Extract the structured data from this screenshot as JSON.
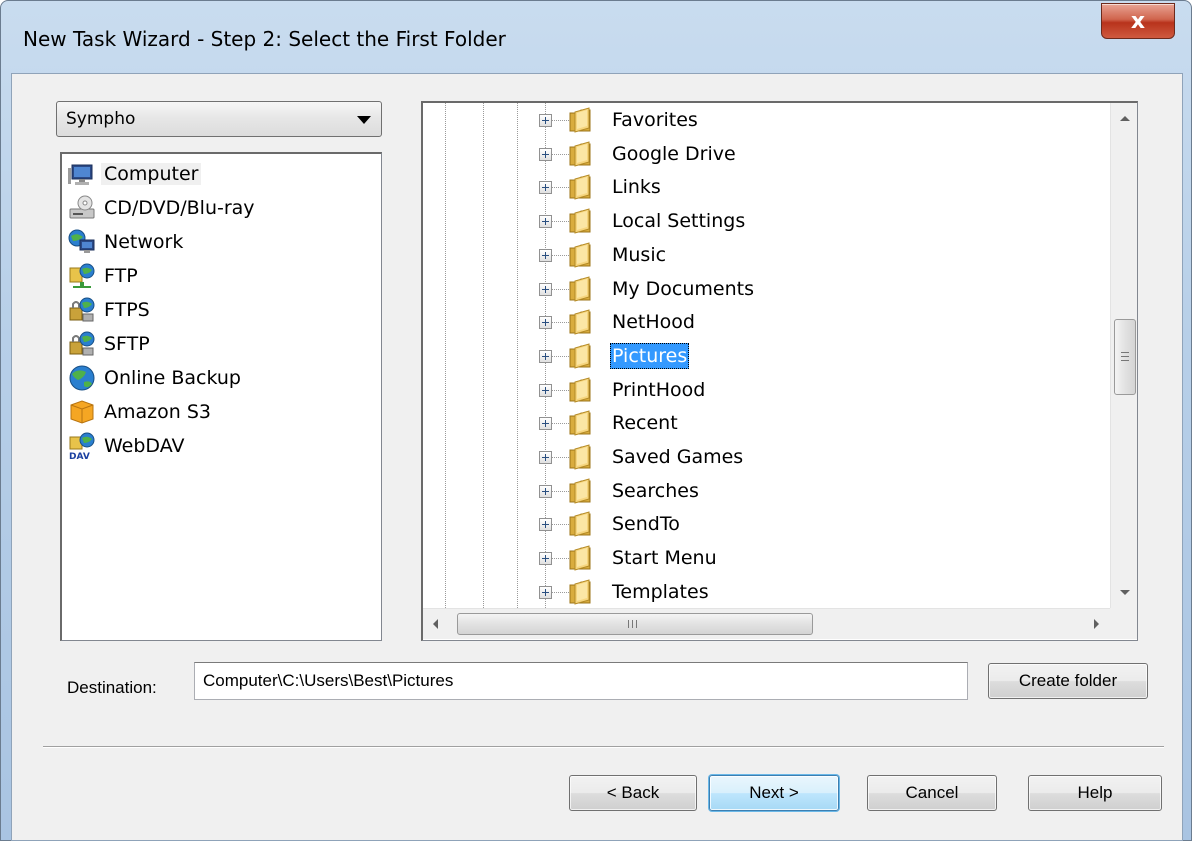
{
  "window": {
    "title": "New Task Wizard - Step 2: Select the First Folder",
    "close_glyph": "x"
  },
  "location_combo": {
    "selected": "Sympho"
  },
  "locations": [
    {
      "label": "Computer",
      "icon": "computer-icon",
      "selected": true
    },
    {
      "label": "CD/DVD/Blu-ray",
      "icon": "cd-drive-icon"
    },
    {
      "label": "Network",
      "icon": "network-icon"
    },
    {
      "label": "FTP",
      "icon": "ftp-icon"
    },
    {
      "label": "FTPS",
      "icon": "ftps-icon"
    },
    {
      "label": "SFTP",
      "icon": "sftp-icon"
    },
    {
      "label": "Online Backup",
      "icon": "globe-icon"
    },
    {
      "label": "Amazon S3",
      "icon": "amazon-s3-icon"
    },
    {
      "label": "WebDAV",
      "icon": "webdav-icon"
    }
  ],
  "webdav_badge": "DAV",
  "tree": {
    "items": [
      {
        "label": "Favorites"
      },
      {
        "label": "Google Drive"
      },
      {
        "label": "Links"
      },
      {
        "label": "Local Settings"
      },
      {
        "label": "Music"
      },
      {
        "label": "My Documents"
      },
      {
        "label": "NetHood"
      },
      {
        "label": "Pictures",
        "selected": true
      },
      {
        "label": "PrintHood"
      },
      {
        "label": "Recent"
      },
      {
        "label": "Saved Games"
      },
      {
        "label": "Searches"
      },
      {
        "label": "SendTo"
      },
      {
        "label": "Start Menu"
      },
      {
        "label": "Templates"
      }
    ]
  },
  "destination": {
    "label": "Destination:",
    "value": "Computer\\C:\\Users\\Best\\Pictures"
  },
  "buttons": {
    "create_folder": "Create folder",
    "back": "< Back",
    "next": "Next >",
    "cancel": "Cancel",
    "help": "Help"
  },
  "colors": {
    "selection": "#3399ff",
    "title_bar": "#b7cfe8",
    "close_button": "#c7472e"
  }
}
